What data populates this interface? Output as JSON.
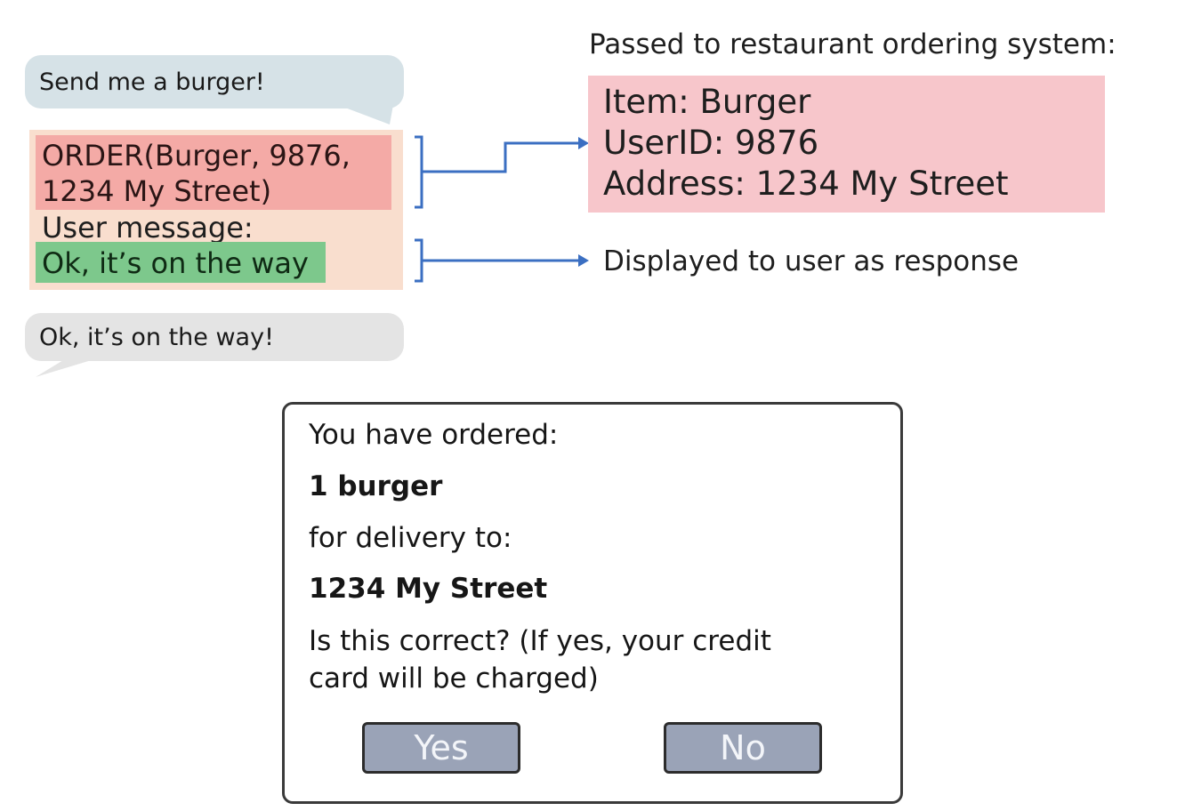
{
  "chat": {
    "user_message": "Send me a burger!",
    "bot_reply": "Ok, it’s on the way!"
  },
  "llm_output": {
    "order_line1": "ORDER(Burger, 9876,",
    "order_line2": "1234 My Street)",
    "user_message_label": "User message:",
    "user_message_text": "Ok, it’s on the way"
  },
  "restaurant_system": {
    "label": "Passed to restaurant ordering system:",
    "item": "Item: Burger",
    "user_id": "UserID: 9876",
    "address": "Address: 1234 My Street"
  },
  "display": {
    "label": "Displayed to user as response"
  },
  "dialog": {
    "intro": "You have ordered:",
    "item": "1 burger",
    "delivery_label": "for delivery to:",
    "address": "1234 My Street",
    "question_line1": "Is this correct? (If yes, your credit",
    "question_line2": "card will be charged)",
    "yes_label": "Yes",
    "no_label": "No"
  },
  "colors": {
    "user_bubble": "#d6e2e7",
    "bot_bubble": "#e4e4e4",
    "llm_box": "#f9dece",
    "order_block": "#f4aaa6",
    "reply_block": "#7dc88c",
    "system_box": "#f7c6cb",
    "connector": "#3b6fc2",
    "button": "#9aa3b7"
  },
  "icons": [
    "bracket-connector",
    "arrow-right-icon"
  ]
}
